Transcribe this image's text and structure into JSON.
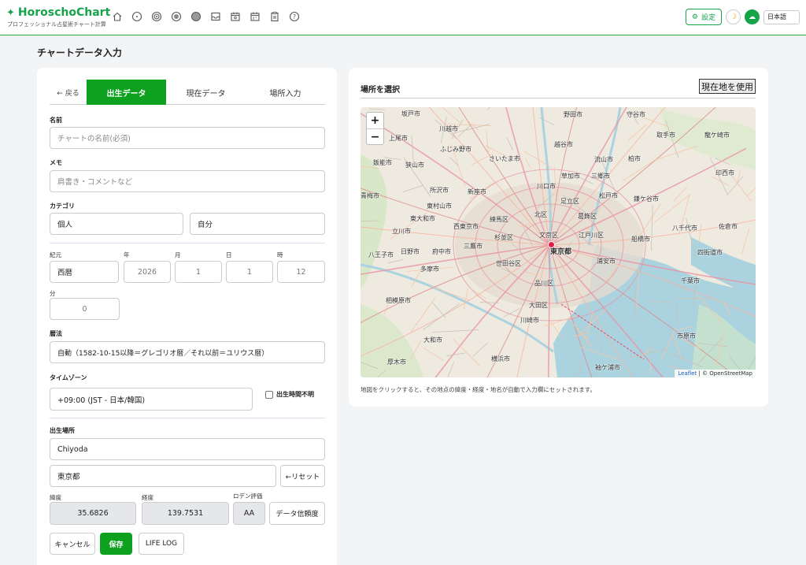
{
  "header": {
    "brand": "HoroschoChart",
    "subtitle": "プロフェッショナル占星術チャート計算",
    "nav_icons": [
      "home-icon",
      "circle-dot-icon",
      "target-icon",
      "double-circle-icon",
      "filled-circle-icon",
      "inbox-icon",
      "calendar-icon",
      "calendar-grid-icon",
      "clipboard-icon",
      "help-icon"
    ],
    "settings_label": "設定",
    "language": "日本語",
    "accent_color": "#16a34a"
  },
  "page_title": "チャートデータ入力",
  "tabs": {
    "back": "← 戻る",
    "birth": "出生データ",
    "current": "現在データ",
    "location": "場所入力"
  },
  "form": {
    "name_label": "名前",
    "name_placeholder": "チャートの名前(必須)",
    "memo_label": "メモ",
    "memo_placeholder": "肩書き・コメントなど",
    "category_label": "カテゴリ",
    "category_1": "個人",
    "category_2": "自分",
    "era_label": "紀元",
    "era_value": "西暦",
    "year_label": "年",
    "year_value": "2026",
    "month_label": "月",
    "month_value": "1",
    "day_label": "日",
    "day_value": "1",
    "hour_label": "時",
    "hour_value": "12",
    "minute_label": "分",
    "minute_value": "0",
    "calendar_label": "暦法",
    "calendar_value": "自動（1582-10-15以降＝グレゴリオ暦／それ以前＝ユリウス暦）",
    "timezone_label": "タイムゾーン",
    "timezone_value": "+09:00 (JST - 日本/韓国)",
    "unknown_time_label": "出生時間不明",
    "place_label": "出生場所",
    "place_value": "Chiyoda",
    "place_detail": "東京都",
    "reset_label": "←リセット",
    "lat_label": "緯度",
    "lat_value": "35.6826",
    "lon_label": "経度",
    "lon_value": "139.7531",
    "rodden_label": "ロデン評価",
    "rodden_value": "AA",
    "reliability_label": "データ信頼度",
    "cancel_label": "キャンセル",
    "save_label": "保存",
    "lifelog_label": "LIFE LOG"
  },
  "map_panel": {
    "title": "場所を選択",
    "use_location": "現在地を使用",
    "zoom_in": "+",
    "zoom_out": "−",
    "attribution_leaflet": "Leaflet",
    "attribution_osm": "| © OpenStreetMap",
    "note": "地図をクリックすると、その地点の緯度・経度・地名が自動で入力欄にセットされます。",
    "labels": [
      "坂戸市",
      "川越市",
      "野田市",
      "守谷市",
      "上尾市",
      "ふじみ野市",
      "さいたま市",
      "越谷市",
      "取手市",
      "龍ケ崎市",
      "飯能市",
      "狭山市",
      "草加市",
      "三郷市",
      "流山市",
      "柏市",
      "所沢市",
      "新座市",
      "川口市",
      "松戸市",
      "印西市",
      "東村山市",
      "足立区",
      "葛飾区",
      "鎌ケ谷市",
      "青梅市",
      "東大和市",
      "北区",
      "船橋市",
      "八千代市",
      "佐倉市",
      "立川市",
      "西東京市",
      "練馬区",
      "八王子市",
      "日野市",
      "府中市",
      "三鷹市",
      "杉並区",
      "文京区",
      "江戸川区",
      "四街道市",
      "東京都",
      "多摩市",
      "世田谷区",
      "浦安市",
      "千葉市",
      "品川区",
      "相模原市",
      "大田区",
      "市原市",
      "川崎市",
      "大和市",
      "厚木市",
      "横浜市",
      "袖ケ浦市"
    ]
  }
}
